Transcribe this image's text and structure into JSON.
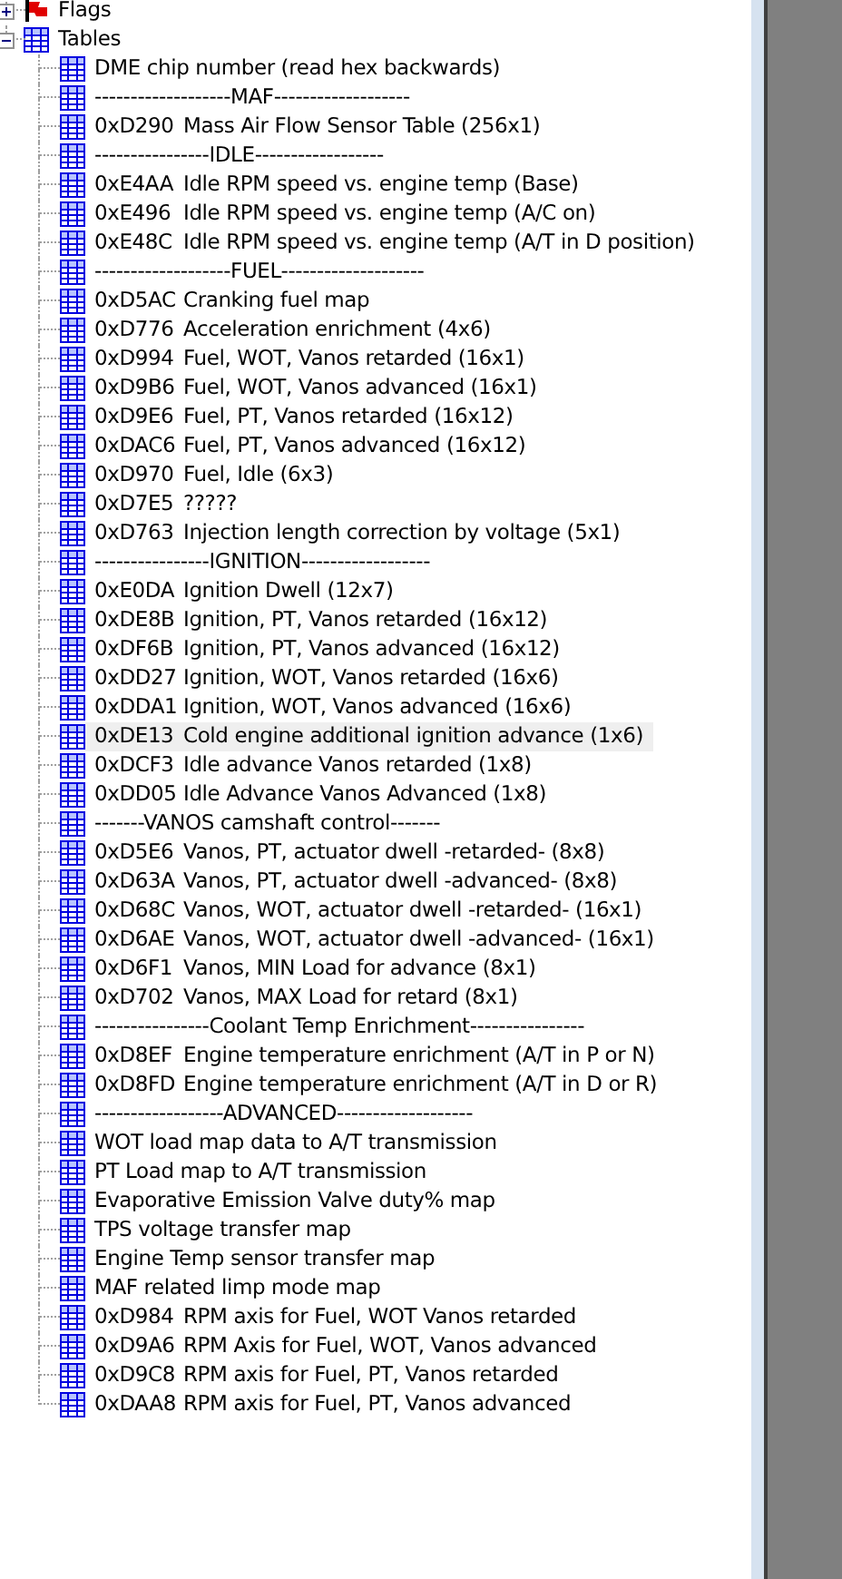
{
  "tree": [
    {
      "label": "Flags",
      "kind": "flags",
      "expanded": false,
      "selected": false
    },
    {
      "label": "Tables",
      "kind": "tables",
      "expanded": true,
      "selected": false,
      "children": [
        {
          "label": "DME chip number (read hex backwards)",
          "selected": false
        },
        {
          "label": "-------------------MAF-------------------",
          "selected": false
        },
        {
          "address": "0xD290",
          "label": "Mass Air Flow Sensor Table (256x1)",
          "selected": false
        },
        {
          "label": "----------------IDLE------------------",
          "selected": false
        },
        {
          "address": "0xE4AA",
          "label": "Idle RPM speed vs. engine temp (Base)",
          "selected": false
        },
        {
          "address": "0xE496",
          "label": "Idle RPM speed vs. engine temp (A/C on)",
          "selected": false
        },
        {
          "address": "0xE48C",
          "label": "Idle RPM speed vs. engine temp (A/T in D position)",
          "selected": false
        },
        {
          "label": "-------------------FUEL--------------------",
          "selected": false
        },
        {
          "address": "0xD5AC",
          "label": "Cranking fuel map",
          "selected": false
        },
        {
          "address": "0xD776",
          "label": "Acceleration enrichment (4x6)",
          "selected": false
        },
        {
          "address": "0xD994",
          "label": "Fuel, WOT, Vanos retarded (16x1)",
          "selected": false
        },
        {
          "address": "0xD9B6",
          "label": "Fuel, WOT, Vanos advanced (16x1)",
          "selected": false
        },
        {
          "address": "0xD9E6",
          "label": "Fuel, PT, Vanos retarded (16x12)",
          "selected": false
        },
        {
          "address": "0xDAC6",
          "label": "Fuel, PT, Vanos advanced (16x12)",
          "selected": false
        },
        {
          "address": "0xD970",
          "label": "Fuel, Idle (6x3)",
          "selected": false
        },
        {
          "address": "0xD7E5",
          "label": "?????",
          "selected": false
        },
        {
          "address": "0xD763",
          "label": "Injection length correction by voltage (5x1)",
          "selected": false
        },
        {
          "label": "----------------IGNITION------------------",
          "selected": false
        },
        {
          "address": "0xE0DA",
          "label": "Ignition Dwell (12x7)",
          "selected": false
        },
        {
          "address": "0xDE8B",
          "label": "Ignition, PT, Vanos retarded (16x12)",
          "selected": false
        },
        {
          "address": "0xDF6B",
          "label": "Ignition, PT, Vanos advanced (16x12)",
          "selected": false
        },
        {
          "address": "0xDD27",
          "label": "Ignition, WOT, Vanos retarded (16x6)",
          "selected": false
        },
        {
          "address": "0xDDA1",
          "label": "Ignition, WOT, Vanos advanced (16x6)",
          "selected": false
        },
        {
          "address": "0xDE13",
          "label": "Cold engine additional ignition advance (1x6)",
          "selected": true
        },
        {
          "address": "0xDCF3",
          "label": "Idle advance Vanos retarded (1x8)",
          "selected": false
        },
        {
          "address": "0xDD05",
          "label": "Idle Advance Vanos Advanced (1x8)",
          "selected": false
        },
        {
          "label": "-------VANOS camshaft control-------",
          "selected": false
        },
        {
          "address": "0xD5E6",
          "label": "Vanos, PT, actuator dwell -retarded- (8x8)",
          "selected": false
        },
        {
          "address": "0xD63A",
          "label": "Vanos, PT, actuator dwell -advanced- (8x8)",
          "selected": false
        },
        {
          "address": "0xD68C",
          "label": "Vanos, WOT, actuator dwell -retarded- (16x1)",
          "selected": false
        },
        {
          "address": "0xD6AE",
          "label": "Vanos, WOT, actuator dwell -advanced- (16x1)",
          "selected": false
        },
        {
          "address": "0xD6F1",
          "label": "Vanos, MIN Load for advance (8x1)",
          "selected": false
        },
        {
          "address": "0xD702",
          "label": "Vanos, MAX Load for retard (8x1)",
          "selected": false
        },
        {
          "label": "----------------Coolant Temp Enrichment----------------",
          "selected": false
        },
        {
          "address": "0xD8EF",
          "label": "Engine temperature enrichment (A/T in P or N)",
          "selected": false
        },
        {
          "address": "0xD8FD",
          "label": "Engine temperature enrichment (A/T in D or R)",
          "selected": false
        },
        {
          "label": "------------------ADVANCED-------------------",
          "selected": false
        },
        {
          "label": "WOT load map data to A/T transmission",
          "selected": false
        },
        {
          "label": "PT Load map to A/T transmission",
          "selected": false
        },
        {
          "label": "Evaporative Emission Valve duty% map",
          "selected": false
        },
        {
          "label": "TPS voltage transfer map",
          "selected": false
        },
        {
          "label": "Engine Temp sensor transfer map",
          "selected": false
        },
        {
          "label": "MAF related limp mode map",
          "selected": false
        },
        {
          "address": "0xD984",
          "label": "RPM axis for Fuel, WOT Vanos retarded",
          "selected": false
        },
        {
          "address": "0xD9A6",
          "label": "RPM Axis for Fuel, WOT, Vanos advanced",
          "selected": false
        },
        {
          "address": "0xD9C8",
          "label": "RPM axis for Fuel, PT, Vanos retarded",
          "selected": false
        },
        {
          "address": "0xDAA8",
          "label": "RPM axis for Fuel, PT, Vanos advanced",
          "selected": false
        }
      ]
    }
  ]
}
